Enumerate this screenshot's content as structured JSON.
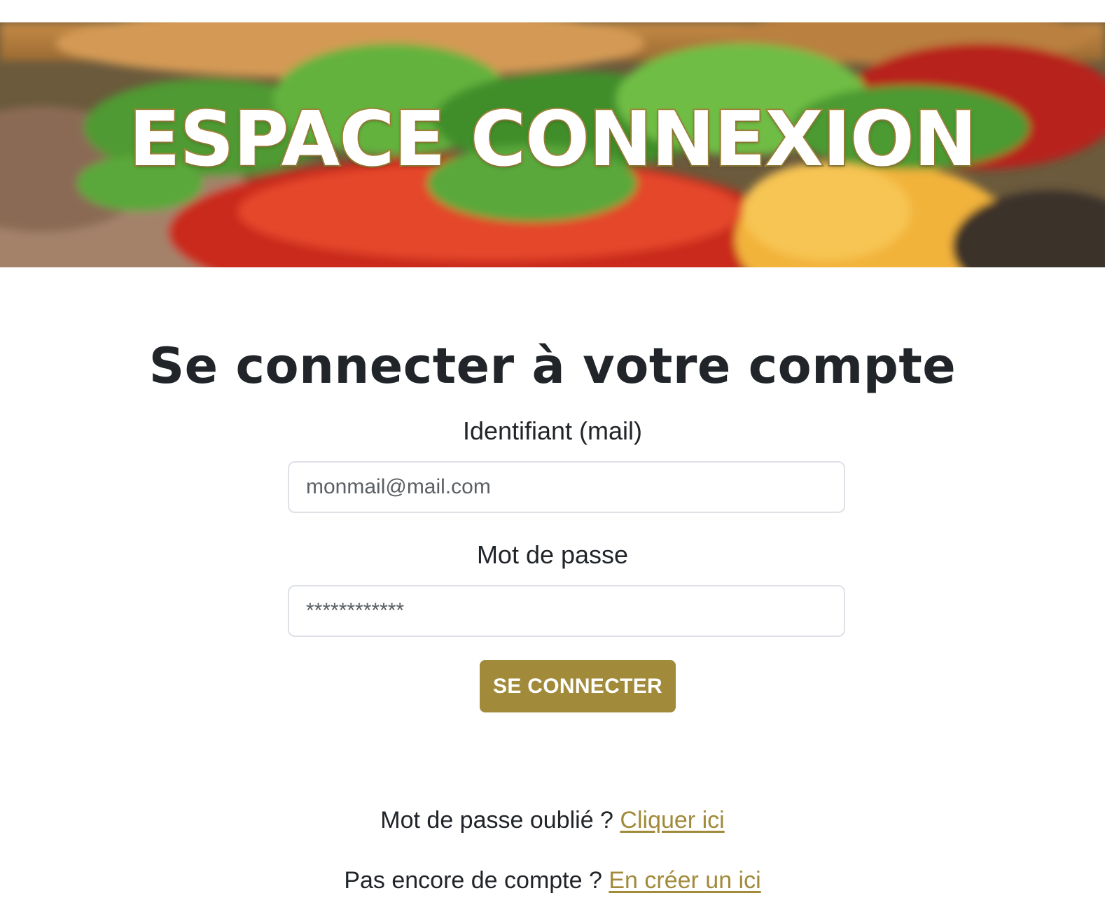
{
  "hero": {
    "title": "ESPACE CONNEXION"
  },
  "login": {
    "heading": "Se connecter à votre compte",
    "email_label": "Identifiant (mail)",
    "email_placeholder": "monmail@mail.com",
    "password_label": "Mot de passe",
    "password_placeholder": "************",
    "submit_label": "SE CONNECTER"
  },
  "links": {
    "forgot_text": "Mot de passe oublié ?",
    "forgot_link": "Cliquer ici",
    "signup_text": "Pas encore de compte ?",
    "signup_link": "En créer un ici"
  },
  "colors": {
    "accent": "#a18a3a",
    "text": "#212529",
    "input_border": "#dee2e6"
  }
}
